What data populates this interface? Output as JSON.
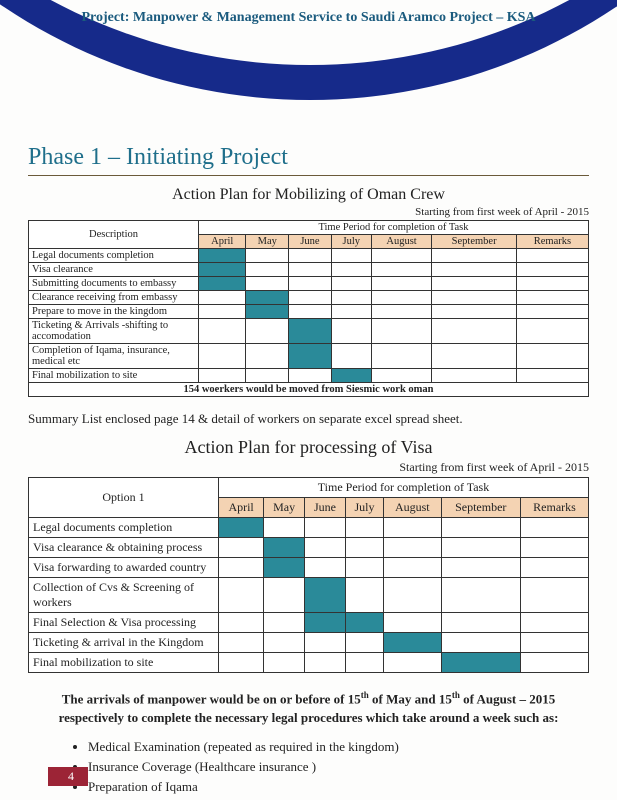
{
  "project_title": "Project: Manpower & Management Service to Saudi Aramco Project – KSA",
  "phase_title": "Phase 1 – Initiating Project",
  "table1": {
    "title": "Action Plan for Mobilizing of Oman Crew",
    "start_note": "Starting from first week of April - 2015",
    "desc_header": "Description",
    "period_header": "Time Period for completion of Task",
    "months": [
      "April",
      "May",
      "June",
      "July",
      "August",
      "September",
      "Remarks"
    ],
    "rows": [
      {
        "label": "Legal documents completion",
        "fill": [
          0
        ]
      },
      {
        "label": "Visa clearance",
        "fill": [
          0
        ]
      },
      {
        "label": "Submitting documents to embassy",
        "fill": [
          0
        ]
      },
      {
        "label": "Clearance receiving from embassy",
        "fill": [
          1
        ]
      },
      {
        "label": "Prepare to move in the kingdom",
        "fill": [
          1
        ]
      },
      {
        "label": "Ticketing & Arrivals -shifting to accomodation",
        "fill": [
          2
        ]
      },
      {
        "label": "Completion of Iqama, insurance, medical etc",
        "fill": [
          2
        ]
      },
      {
        "label": "Final mobilization to site",
        "fill": [
          3
        ]
      }
    ],
    "footer": "154 woerkers would be moved from Siesmic work oman"
  },
  "summary_line": "Summary List enclosed page 14 & detail of workers on separate excel spread sheet.",
  "table2": {
    "title": "Action Plan for processing of Visa",
    "start_note": "Starting from first week of April - 2015",
    "desc_header": "Option 1",
    "period_header": "Time Period for completion of Task",
    "months": [
      "April",
      "May",
      "June",
      "July",
      "August",
      "September",
      "Remarks"
    ],
    "rows": [
      {
        "label": "Legal documents completion",
        "fill": [
          0
        ]
      },
      {
        "label": "Visa clearance & obtaining process",
        "fill": [
          1
        ]
      },
      {
        "label": "Visa forwarding to awarded country",
        "fill": [
          1
        ]
      },
      {
        "label": "Collection of Cvs & Screening of workers",
        "fill": [
          2
        ]
      },
      {
        "label": "Final Selection & Visa processing",
        "fill": [
          2,
          3
        ]
      },
      {
        "label": "Ticketing & arrival in the Kingdom",
        "fill": [
          4
        ]
      },
      {
        "label": "Final mobilization to site",
        "fill": [
          5
        ]
      }
    ]
  },
  "arrivals_text": {
    "pre": "The arrivals of manpower would be on or before of 15",
    "th1": "th",
    "mid1": " of May and 15",
    "th2": "th",
    "mid2": " of August – 2015 respectively to complete the necessary legal procedures which take around a week such as:"
  },
  "bullets": [
    "Medical Examination (repeated as required in the kingdom)",
    "Insurance Coverage (Healthcare insurance )",
    "Preparation of Iqama"
  ],
  "page_number": "4",
  "chart_data": [
    {
      "type": "table",
      "title": "Action Plan for Mobilizing of Oman Crew",
      "columns": [
        "April",
        "May",
        "June",
        "July",
        "August",
        "September"
      ],
      "rows": [
        {
          "task": "Legal documents completion",
          "months": [
            "April"
          ]
        },
        {
          "task": "Visa clearance",
          "months": [
            "April"
          ]
        },
        {
          "task": "Submitting documents to embassy",
          "months": [
            "April"
          ]
        },
        {
          "task": "Clearance receiving from embassy",
          "months": [
            "May"
          ]
        },
        {
          "task": "Prepare to move in the kingdom",
          "months": [
            "May"
          ]
        },
        {
          "task": "Ticketing & Arrivals -shifting to accomodation",
          "months": [
            "June"
          ]
        },
        {
          "task": "Completion of Iqama, insurance, medical etc",
          "months": [
            "June"
          ]
        },
        {
          "task": "Final mobilization to site",
          "months": [
            "July"
          ]
        }
      ],
      "footer_note": "154 woerkers would be moved from Siesmic work oman"
    },
    {
      "type": "table",
      "title": "Action Plan for processing of Visa",
      "columns": [
        "April",
        "May",
        "June",
        "July",
        "August",
        "September"
      ],
      "rows": [
        {
          "task": "Legal documents completion",
          "months": [
            "April"
          ]
        },
        {
          "task": "Visa clearance & obtaining process",
          "months": [
            "May"
          ]
        },
        {
          "task": "Visa forwarding to awarded country",
          "months": [
            "May"
          ]
        },
        {
          "task": "Collection of Cvs & Screening of workers",
          "months": [
            "June"
          ]
        },
        {
          "task": "Final Selection & Visa processing",
          "months": [
            "June",
            "July"
          ]
        },
        {
          "task": "Ticketing & arrival in the Kingdom",
          "months": [
            "August"
          ]
        },
        {
          "task": "Final mobilization to site",
          "months": [
            "September"
          ]
        }
      ]
    }
  ]
}
